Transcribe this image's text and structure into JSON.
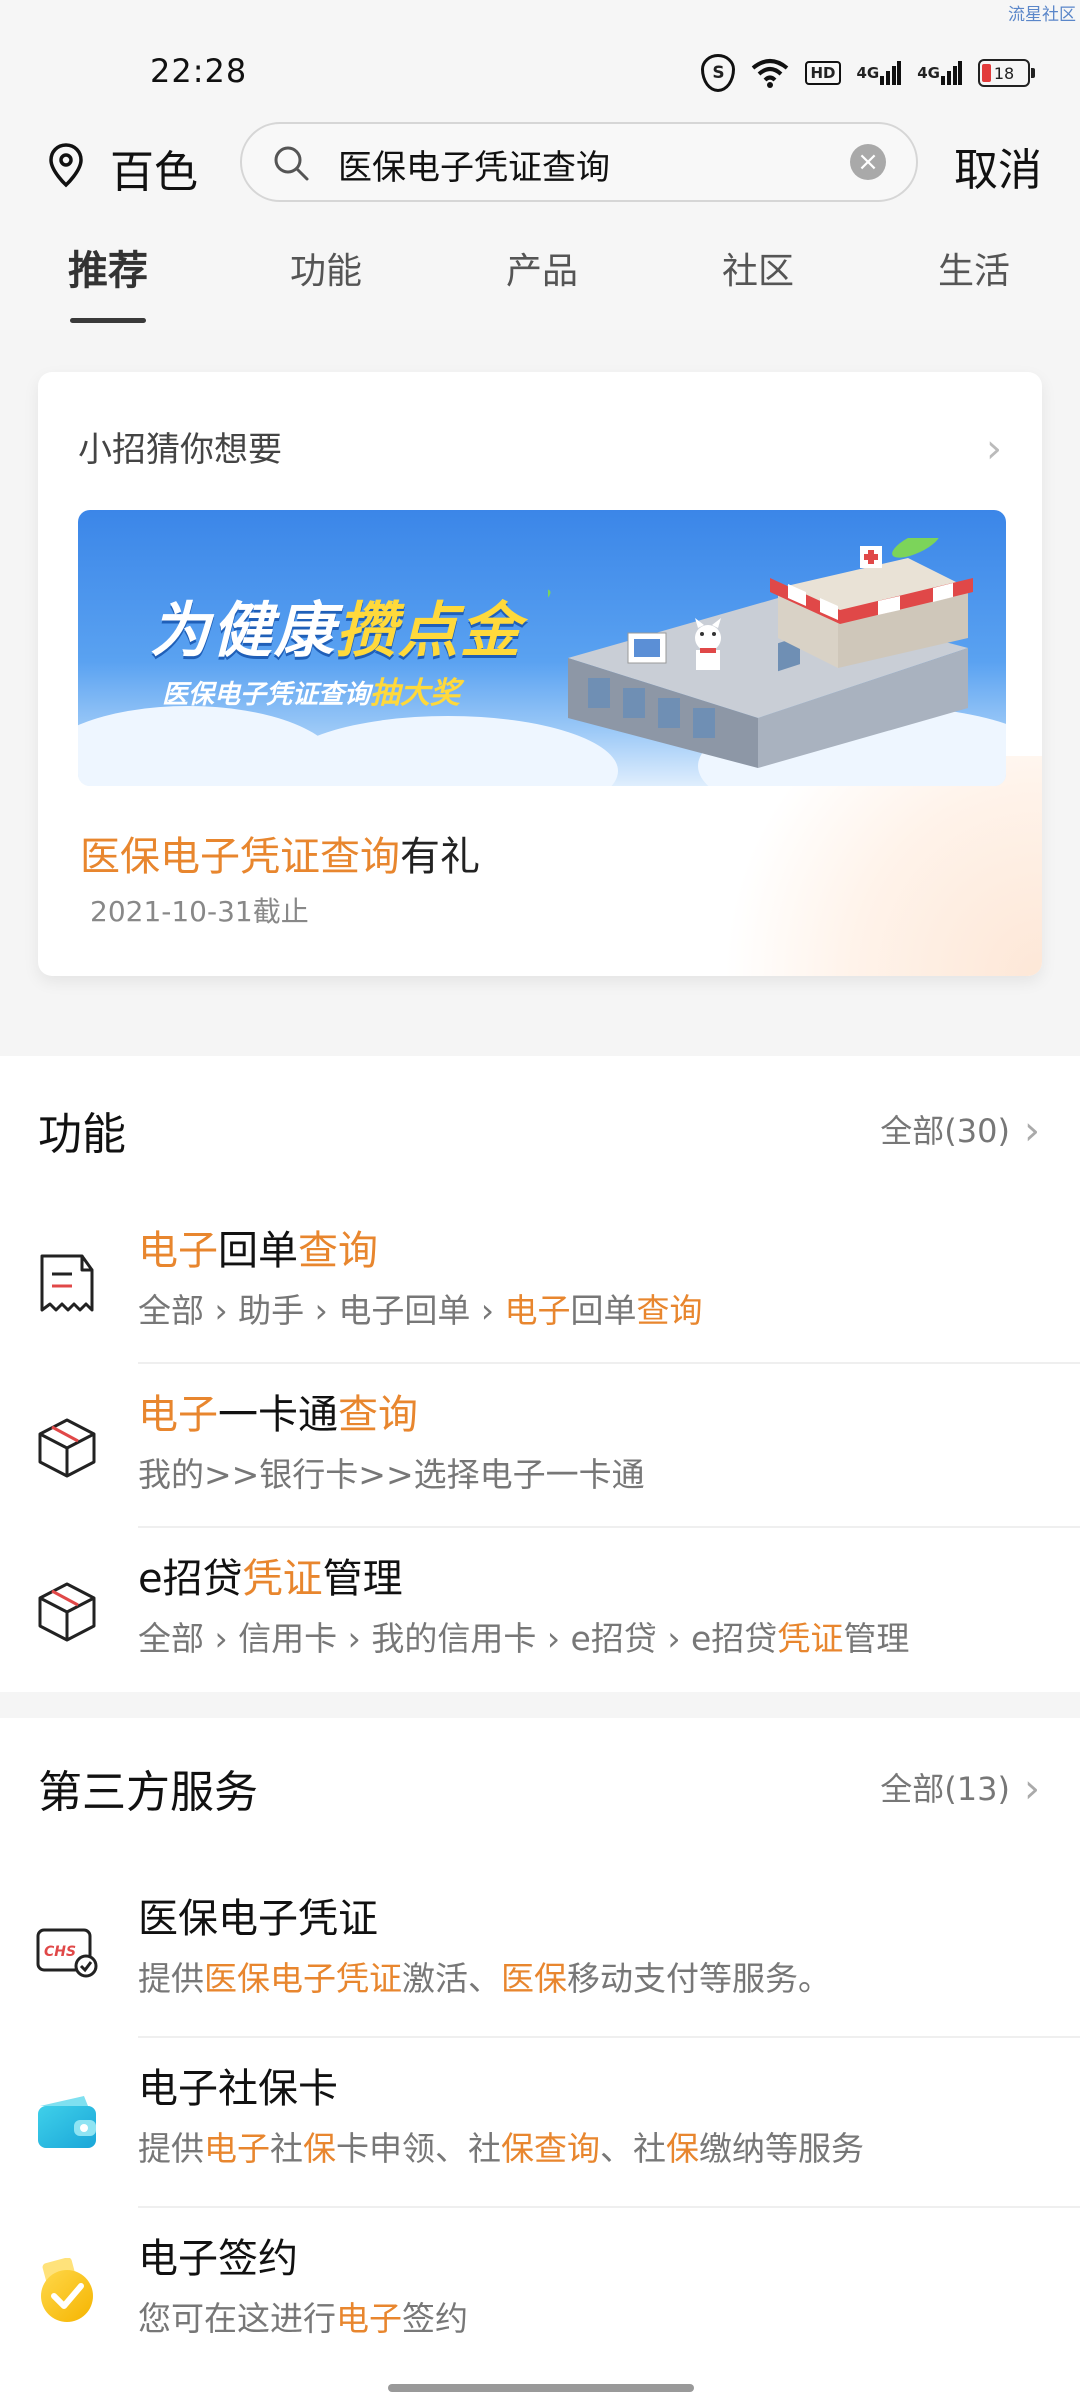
{
  "watermark": "流星社区",
  "status_bar": {
    "time": "22:28",
    "network_1": "4G",
    "network_2": "4G",
    "hd_label": "HD",
    "battery": "18",
    "shield_label": "S"
  },
  "search": {
    "city": "百色",
    "query": "医保电子凭证查询",
    "clear_icon": "×",
    "cancel_label": "取消"
  },
  "tabs": [
    {
      "label": "推荐",
      "active": true
    },
    {
      "label": "功能"
    },
    {
      "label": "产品"
    },
    {
      "label": "社区"
    },
    {
      "label": "生活"
    }
  ],
  "recommend_card": {
    "title": "小招猜你想要",
    "banner_title_a": "为健康",
    "banner_title_b": "攒点金",
    "banner_sub_a": "医保电子凭证查询",
    "banner_sub_b": "抽大奖",
    "promo_highlight": "医保电子凭证查询",
    "promo_rest": "有礼",
    "deadline": "2021-10-31截止"
  },
  "functions": {
    "title": "功能",
    "all_label": "全部(30)",
    "items": [
      {
        "icon": "receipt-icon",
        "title": [
          {
            "text": "电子",
            "hl": true
          },
          {
            "text": "回单"
          },
          {
            "text": "查询",
            "hl": true
          }
        ],
        "path": [
          {
            "text": "全部 › 助手 › 电子回单 › "
          },
          {
            "text": "电子",
            "hl": true
          },
          {
            "text": "回单"
          },
          {
            "text": "查询",
            "hl": true
          }
        ]
      },
      {
        "icon": "box-icon",
        "title": [
          {
            "text": "电子",
            "hl": true
          },
          {
            "text": "一卡通"
          },
          {
            "text": "查询",
            "hl": true
          }
        ],
        "path": [
          {
            "text": "我的>>银行卡>>选择电子一卡通"
          }
        ]
      },
      {
        "icon": "box-icon",
        "title": [
          {
            "text": "e招贷"
          },
          {
            "text": "凭证",
            "hl": true
          },
          {
            "text": "管理"
          }
        ],
        "path": [
          {
            "text": "全部 › 信用卡 › 我的信用卡 › e招贷 › e招贷"
          },
          {
            "text": "凭证",
            "hl": true
          },
          {
            "text": "管理"
          }
        ]
      }
    ]
  },
  "third_party": {
    "title": "第三方服务",
    "all_label": "全部(13)",
    "items": [
      {
        "icon": "chs-icon",
        "icon_text": "CHS",
        "title": [
          {
            "text": "医保电子凭证"
          }
        ],
        "path": [
          {
            "text": "提供"
          },
          {
            "text": "医保电子凭证",
            "hl": true
          },
          {
            "text": "激活、"
          },
          {
            "text": "医保",
            "hl": true
          },
          {
            "text": "移动支付等服务。"
          }
        ]
      },
      {
        "icon": "wallet-icon",
        "title": [
          {
            "text": "电子社保卡"
          }
        ],
        "path": [
          {
            "text": "提供"
          },
          {
            "text": "电子",
            "hl": true
          },
          {
            "text": "社"
          },
          {
            "text": "保",
            "hl": true
          },
          {
            "text": "卡申领、社"
          },
          {
            "text": "保查询",
            "hl": true
          },
          {
            "text": "、社"
          },
          {
            "text": "保",
            "hl": true
          },
          {
            "text": "缴纳等服务"
          }
        ]
      },
      {
        "icon": "check-badge-icon",
        "title": [
          {
            "text": "电子签约"
          }
        ],
        "path": [
          {
            "text": "您可在这进行"
          },
          {
            "text": "电子",
            "hl": true
          },
          {
            "text": "签约"
          }
        ]
      }
    ]
  },
  "colors": {
    "highlight": "#e8862e",
    "text": "#111111",
    "muted": "#777777"
  }
}
